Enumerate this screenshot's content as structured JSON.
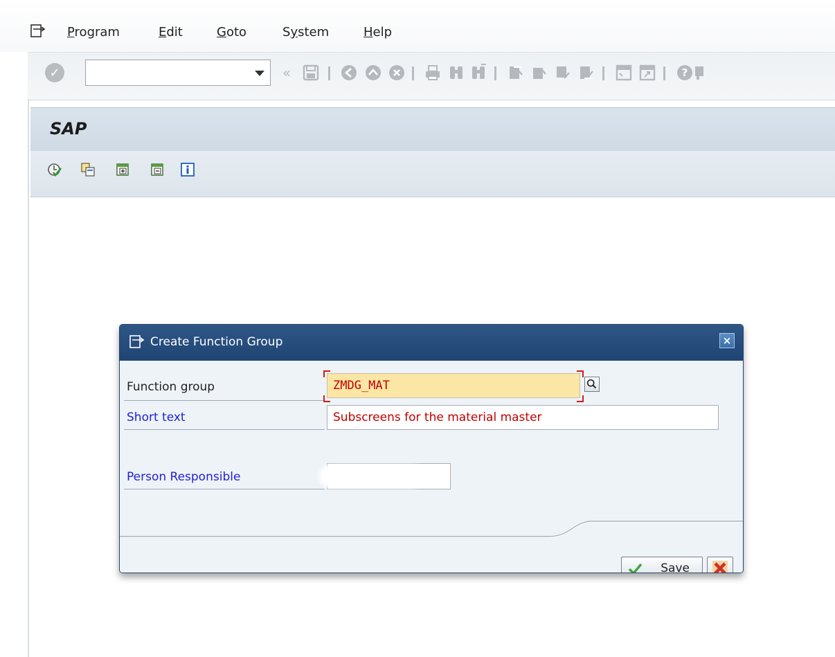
{
  "menu": {
    "items": [
      {
        "pre": "",
        "u": "P",
        "post": "rogram"
      },
      {
        "pre": "",
        "u": "E",
        "post": "dit"
      },
      {
        "pre": "",
        "u": "G",
        "post": "oto"
      },
      {
        "pre": "S",
        "u": "y",
        "post": "stem"
      },
      {
        "pre": "",
        "u": "H",
        "post": "elp"
      }
    ]
  },
  "toolbar": {
    "command_field_value": "",
    "back_chevron": "«"
  },
  "screen": {
    "title": "SAP"
  },
  "dialog": {
    "title": "Create Function Group",
    "close_glyph": "×",
    "fields": {
      "function_group": {
        "label": "Function group",
        "value": "ZMDG_MAT"
      },
      "short_text": {
        "label": "Short text",
        "value": "Subscreens for the material master"
      },
      "person_responsible": {
        "label": "Person Responsible",
        "value": ""
      }
    },
    "buttons": {
      "save": "Save"
    }
  },
  "colors": {
    "dialog_title_bg": "#1f4474",
    "required_field_bg": "#fbe6a5",
    "label_blue": "#2121d6",
    "value_red": "#c00000"
  },
  "icons": [
    "menu-icon",
    "enter-icon",
    "save-icon",
    "back-icon",
    "exit-icon",
    "cancel-icon",
    "print-icon",
    "find-icon",
    "find-next-icon",
    "first-page-icon",
    "previous-page-icon",
    "next-page-icon",
    "last-page-icon",
    "new-session-icon",
    "shortcut-icon",
    "help-icon",
    "check-icon",
    "copy-icon",
    "expand-icon",
    "collapse-icon",
    "info-icon",
    "search-help-icon"
  ]
}
